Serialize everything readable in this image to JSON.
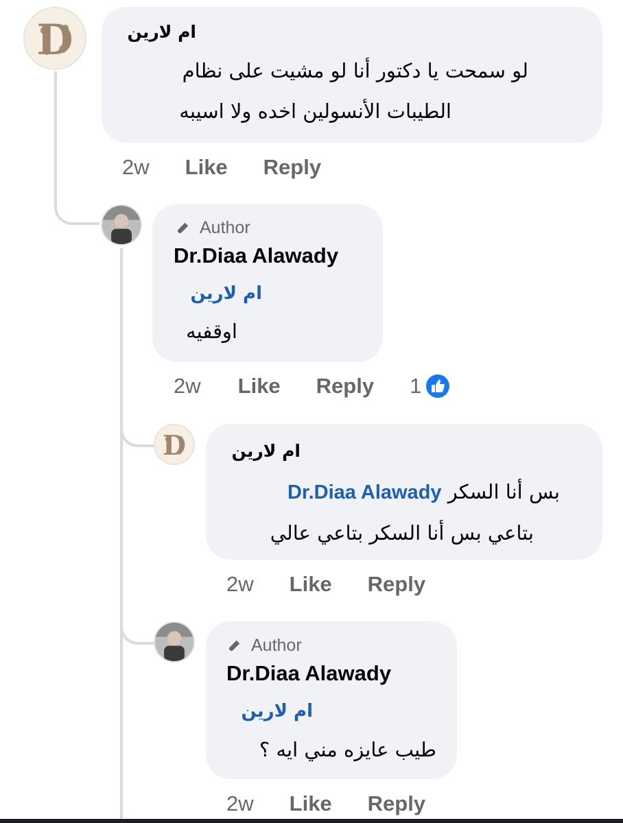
{
  "comments": [
    {
      "author_name": "ام لارين",
      "text_lines": [
        "لو سمحت يا دكتور أنا لو مشيت على نظام",
        "الطيبات الأنسولين اخده ولا اسيبه"
      ],
      "time": "2w",
      "like_label": "Like",
      "reply_label": "Reply",
      "avatar_letter": "D"
    },
    {
      "badge": "Author",
      "author_name": "Dr.Diaa Alawady",
      "mention": "ام لارين",
      "text": "اوقفيه",
      "time": "2w",
      "like_label": "Like",
      "reply_label": "Reply",
      "reaction_count": "1"
    },
    {
      "author_name": "ام لارين",
      "line1_mention": "Dr.Diaa Alawady",
      "line1_text": "بس أنا السكر",
      "line2_text": "بتاعي بس أنا السكر بتاعي عالي",
      "time": "2w",
      "like_label": "Like",
      "reply_label": "Reply",
      "avatar_letter": "D"
    },
    {
      "badge": "Author",
      "author_name": "Dr.Diaa Alawady",
      "mention": "ام لارين",
      "text": "طيب عايزه مني ايه ؟",
      "time": "2w",
      "like_label": "Like",
      "reply_label": "Reply"
    }
  ],
  "colors": {
    "bubble": "#f0f2f5",
    "mention": "#1d5fb3",
    "meta": "#65676b",
    "thread_line": "#d9dbe0",
    "like_blue": "#1877f2"
  },
  "icons": [
    "pencil-icon",
    "like-thumb-icon"
  ]
}
